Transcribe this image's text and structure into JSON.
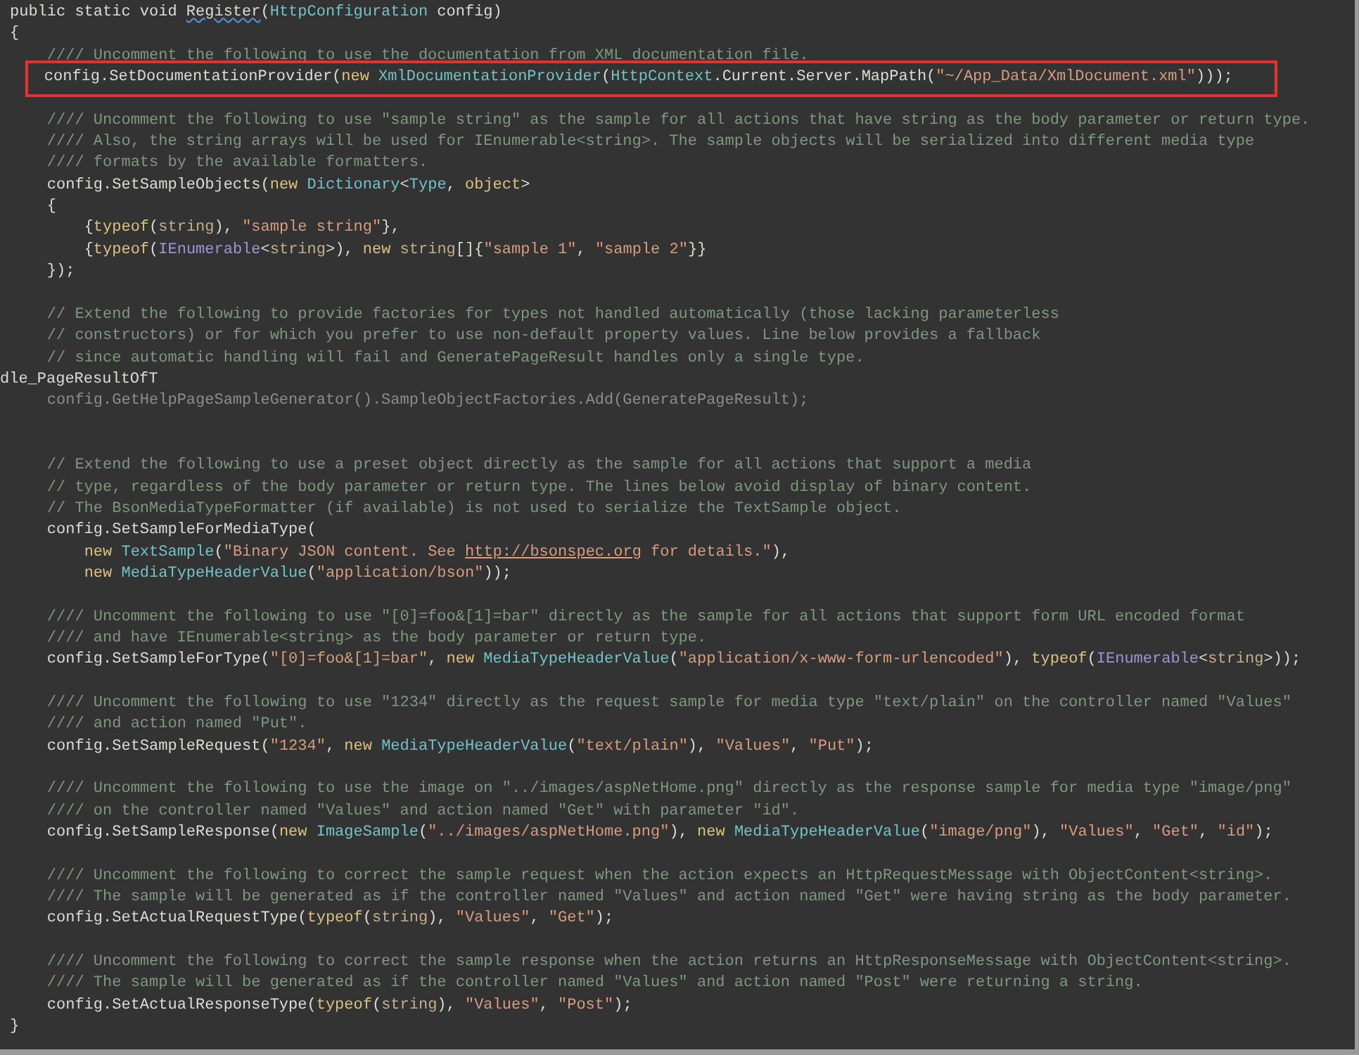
{
  "editor": {
    "lines": [
      {
        "kind": "code",
        "tokens": [
          {
            "kind": "plain",
            "text": "public static void "
          },
          {
            "kind": "error",
            "text": "Register"
          },
          {
            "kind": "plain",
            "text": "("
          },
          {
            "kind": "type",
            "text": "HttpConfiguration"
          },
          {
            "kind": "plain",
            "text": " config)"
          }
        ]
      },
      {
        "kind": "code",
        "tokens": [
          {
            "kind": "plain",
            "text": "{"
          }
        ]
      },
      {
        "kind": "code",
        "tokens": [
          {
            "kind": "comment",
            "text": "    //// Uncomment the following to use the documentation from XML documentation file."
          }
        ]
      },
      {
        "kind": "boxed",
        "tokens": [
          {
            "kind": "plain",
            "text": "    config.SetDocumentationProvider("
          },
          {
            "kind": "keyword",
            "text": "new"
          },
          {
            "kind": "type",
            "text": " XmlDocumentationProvider"
          },
          {
            "kind": "plain",
            "text": "("
          },
          {
            "kind": "type",
            "text": "HttpContext"
          },
          {
            "kind": "plain",
            "text": ".Current.Server.MapPath("
          },
          {
            "kind": "string",
            "text": "\"~/App_Data/XmlDocument.xml\""
          },
          {
            "kind": "plain",
            "text": ")));"
          }
        ]
      },
      {
        "kind": "blank"
      },
      {
        "kind": "code",
        "tokens": [
          {
            "kind": "comment",
            "text": "    //// Uncomment the following to use \"sample string\" as the sample for all actions that have string as the body parameter or return type."
          }
        ]
      },
      {
        "kind": "code",
        "tokens": [
          {
            "kind": "comment",
            "text": "    //// Also, the string arrays will be used for IEnumerable<string>. The sample objects will be serialized into different media type"
          }
        ]
      },
      {
        "kind": "code",
        "tokens": [
          {
            "kind": "comment",
            "text": "    //// formats by the available formatters."
          }
        ]
      },
      {
        "kind": "code",
        "tokens": [
          {
            "kind": "plain",
            "text": "    config.SetSampleObjects("
          },
          {
            "kind": "keyword",
            "text": "new"
          },
          {
            "kind": "type",
            "text": " Dictionary"
          },
          {
            "kind": "plain",
            "text": "<"
          },
          {
            "kind": "type",
            "text": "Type"
          },
          {
            "kind": "plain",
            "text": ", "
          },
          {
            "kind": "keyword",
            "text": "object"
          },
          {
            "kind": "plain",
            "text": ">"
          }
        ]
      },
      {
        "kind": "code",
        "tokens": [
          {
            "kind": "plain",
            "text": "    {"
          }
        ]
      },
      {
        "kind": "code",
        "tokens": [
          {
            "kind": "plain",
            "text": "        {"
          },
          {
            "kind": "keyword",
            "text": "typeof"
          },
          {
            "kind": "plain",
            "text": "("
          },
          {
            "kind": "builtin",
            "text": "string"
          },
          {
            "kind": "plain",
            "text": "), "
          },
          {
            "kind": "string",
            "text": "\"sample string\""
          },
          {
            "kind": "plain",
            "text": "},"
          }
        ]
      },
      {
        "kind": "code",
        "tokens": [
          {
            "kind": "plain",
            "text": "        {"
          },
          {
            "kind": "keyword",
            "text": "typeof"
          },
          {
            "kind": "plain",
            "text": "("
          },
          {
            "kind": "interface",
            "text": "IEnumerable"
          },
          {
            "kind": "plain",
            "text": "<"
          },
          {
            "kind": "builtin",
            "text": "string"
          },
          {
            "kind": "plain",
            "text": ">), "
          },
          {
            "kind": "keyword",
            "text": "new"
          },
          {
            "kind": "builtin",
            "text": " string"
          },
          {
            "kind": "plain",
            "text": "[]{"
          },
          {
            "kind": "string",
            "text": "\"sample 1\""
          },
          {
            "kind": "plain",
            "text": ", "
          },
          {
            "kind": "string",
            "text": "\"sample 2\""
          },
          {
            "kind": "plain",
            "text": "}}"
          }
        ]
      },
      {
        "kind": "code",
        "tokens": [
          {
            "kind": "plain",
            "text": "    });"
          }
        ]
      },
      {
        "kind": "blank"
      },
      {
        "kind": "code",
        "tokens": [
          {
            "kind": "comment",
            "text": "    // Extend the following to provide factories for types not handled automatically (those lacking parameterless"
          }
        ]
      },
      {
        "kind": "code",
        "tokens": [
          {
            "kind": "comment",
            "text": "    // constructors) or for which you prefer to use non-default property values. Line below provides a fallback"
          }
        ]
      },
      {
        "kind": "code",
        "tokens": [
          {
            "kind": "comment",
            "text": "    // since automatic handling will fail and GeneratePageResult handles only a single type."
          }
        ]
      },
      {
        "kind": "region",
        "tokens": [
          {
            "kind": "plain",
            "text": "dle_PageResultOfT"
          }
        ]
      },
      {
        "kind": "code",
        "tokens": [
          {
            "kind": "faded",
            "text": "    config.GetHelpPageSampleGenerator().SampleObjectFactories.Add(GeneratePageResult);"
          }
        ]
      },
      {
        "kind": "blank"
      },
      {
        "kind": "blank"
      },
      {
        "kind": "code",
        "tokens": [
          {
            "kind": "comment",
            "text": "    // Extend the following to use a preset object directly as the sample for all actions that support a media"
          }
        ]
      },
      {
        "kind": "code",
        "tokens": [
          {
            "kind": "comment",
            "text": "    // type, regardless of the body parameter or return type. The lines below avoid display of binary content."
          }
        ]
      },
      {
        "kind": "code",
        "tokens": [
          {
            "kind": "comment",
            "text": "    // The BsonMediaTypeFormatter (if available) is not used to serialize the TextSample object."
          }
        ]
      },
      {
        "kind": "code",
        "tokens": [
          {
            "kind": "plain",
            "text": "    config.SetSampleForMediaType("
          }
        ]
      },
      {
        "kind": "code",
        "tokens": [
          {
            "kind": "keyword",
            "text": "        new"
          },
          {
            "kind": "type",
            "text": " TextSample"
          },
          {
            "kind": "plain",
            "text": "("
          },
          {
            "kind": "string",
            "text": "\"Binary JSON content. See "
          },
          {
            "kind": "link",
            "text": "http://bsonspec.org"
          },
          {
            "kind": "string",
            "text": " for details.\""
          },
          {
            "kind": "plain",
            "text": "),"
          }
        ]
      },
      {
        "kind": "code",
        "tokens": [
          {
            "kind": "keyword",
            "text": "        new"
          },
          {
            "kind": "type",
            "text": " MediaTypeHeaderValue"
          },
          {
            "kind": "plain",
            "text": "("
          },
          {
            "kind": "string",
            "text": "\"application/bson\""
          },
          {
            "kind": "plain",
            "text": "));"
          }
        ]
      },
      {
        "kind": "blank"
      },
      {
        "kind": "code",
        "tokens": [
          {
            "kind": "comment",
            "text": "    //// Uncomment the following to use \"[0]=foo&[1]=bar\" directly as the sample for all actions that support form URL encoded format"
          }
        ]
      },
      {
        "kind": "code",
        "tokens": [
          {
            "kind": "comment",
            "text": "    //// and have IEnumerable<string> as the body parameter or return type."
          }
        ]
      },
      {
        "kind": "code",
        "tokens": [
          {
            "kind": "plain",
            "text": "    config.SetSampleForType("
          },
          {
            "kind": "string",
            "text": "\"[0]=foo&[1]=bar\""
          },
          {
            "kind": "plain",
            "text": ", "
          },
          {
            "kind": "keyword",
            "text": "new"
          },
          {
            "kind": "type",
            "text": " MediaTypeHeaderValue"
          },
          {
            "kind": "plain",
            "text": "("
          },
          {
            "kind": "string",
            "text": "\"application/x-www-form-urlencoded\""
          },
          {
            "kind": "plain",
            "text": "), "
          },
          {
            "kind": "keyword",
            "text": "typeof"
          },
          {
            "kind": "plain",
            "text": "("
          },
          {
            "kind": "interface",
            "text": "IEnumerable"
          },
          {
            "kind": "plain",
            "text": "<"
          },
          {
            "kind": "builtin",
            "text": "string"
          },
          {
            "kind": "plain",
            "text": ">));"
          }
        ]
      },
      {
        "kind": "blank"
      },
      {
        "kind": "code",
        "tokens": [
          {
            "kind": "comment",
            "text": "    //// Uncomment the following to use \"1234\" directly as the request sample for media type \"text/plain\" on the controller named \"Values\""
          }
        ]
      },
      {
        "kind": "code",
        "tokens": [
          {
            "kind": "comment",
            "text": "    //// and action named \"Put\"."
          }
        ]
      },
      {
        "kind": "code",
        "tokens": [
          {
            "kind": "plain",
            "text": "    config.SetSampleRequest("
          },
          {
            "kind": "string",
            "text": "\"1234\""
          },
          {
            "kind": "plain",
            "text": ", "
          },
          {
            "kind": "keyword",
            "text": "new"
          },
          {
            "kind": "type",
            "text": " MediaTypeHeaderValue"
          },
          {
            "kind": "plain",
            "text": "("
          },
          {
            "kind": "string",
            "text": "\"text/plain\""
          },
          {
            "kind": "plain",
            "text": "), "
          },
          {
            "kind": "string",
            "text": "\"Values\""
          },
          {
            "kind": "plain",
            "text": ", "
          },
          {
            "kind": "string",
            "text": "\"Put\""
          },
          {
            "kind": "plain",
            "text": ");"
          }
        ]
      },
      {
        "kind": "blank"
      },
      {
        "kind": "code",
        "tokens": [
          {
            "kind": "comment",
            "text": "    //// Uncomment the following to use the image on \"../images/aspNetHome.png\" directly as the response sample for media type \"image/png\""
          }
        ]
      },
      {
        "kind": "code",
        "tokens": [
          {
            "kind": "comment",
            "text": "    //// on the controller named \"Values\" and action named \"Get\" with parameter \"id\"."
          }
        ]
      },
      {
        "kind": "code",
        "tokens": [
          {
            "kind": "plain",
            "text": "    config.SetSampleResponse("
          },
          {
            "kind": "keyword",
            "text": "new"
          },
          {
            "kind": "type",
            "text": " ImageSample"
          },
          {
            "kind": "plain",
            "text": "("
          },
          {
            "kind": "string",
            "text": "\"../images/aspNetHome.png\""
          },
          {
            "kind": "plain",
            "text": "), "
          },
          {
            "kind": "keyword",
            "text": "new"
          },
          {
            "kind": "type",
            "text": " MediaTypeHeaderValue"
          },
          {
            "kind": "plain",
            "text": "("
          },
          {
            "kind": "string",
            "text": "\"image/png\""
          },
          {
            "kind": "plain",
            "text": "), "
          },
          {
            "kind": "string",
            "text": "\"Values\""
          },
          {
            "kind": "plain",
            "text": ", "
          },
          {
            "kind": "string",
            "text": "\"Get\""
          },
          {
            "kind": "plain",
            "text": ", "
          },
          {
            "kind": "string",
            "text": "\"id\""
          },
          {
            "kind": "plain",
            "text": ");"
          }
        ]
      },
      {
        "kind": "blank"
      },
      {
        "kind": "code",
        "tokens": [
          {
            "kind": "comment",
            "text": "    //// Uncomment the following to correct the sample request when the action expects an HttpRequestMessage with ObjectContent<string>."
          }
        ]
      },
      {
        "kind": "code",
        "tokens": [
          {
            "kind": "comment",
            "text": "    //// The sample will be generated as if the controller named \"Values\" and action named \"Get\" were having string as the body parameter."
          }
        ]
      },
      {
        "kind": "code",
        "tokens": [
          {
            "kind": "plain",
            "text": "    config.SetActualRequestType("
          },
          {
            "kind": "keyword",
            "text": "typeof"
          },
          {
            "kind": "plain",
            "text": "("
          },
          {
            "kind": "builtin",
            "text": "string"
          },
          {
            "kind": "plain",
            "text": "), "
          },
          {
            "kind": "string",
            "text": "\"Values\""
          },
          {
            "kind": "plain",
            "text": ", "
          },
          {
            "kind": "string",
            "text": "\"Get\""
          },
          {
            "kind": "plain",
            "text": ");"
          }
        ]
      },
      {
        "kind": "blank"
      },
      {
        "kind": "code",
        "tokens": [
          {
            "kind": "comment",
            "text": "    //// Uncomment the following to correct the sample response when the action returns an HttpResponseMessage with ObjectContent<string>."
          }
        ]
      },
      {
        "kind": "code",
        "tokens": [
          {
            "kind": "comment",
            "text": "    //// The sample will be generated as if the controller named \"Values\" and action named \"Post\" were returning a string."
          }
        ]
      },
      {
        "kind": "code",
        "tokens": [
          {
            "kind": "plain",
            "text": "    config.SetActualResponseType("
          },
          {
            "kind": "keyword",
            "text": "typeof"
          },
          {
            "kind": "plain",
            "text": "("
          },
          {
            "kind": "builtin",
            "text": "string"
          },
          {
            "kind": "plain",
            "text": "), "
          },
          {
            "kind": "string",
            "text": "\"Values\""
          },
          {
            "kind": "plain",
            "text": ", "
          },
          {
            "kind": "string",
            "text": "\"Post\""
          },
          {
            "kind": "plain",
            "text": ");"
          }
        ]
      },
      {
        "kind": "code",
        "tokens": [
          {
            "kind": "plain",
            "text": "}"
          }
        ]
      }
    ]
  }
}
